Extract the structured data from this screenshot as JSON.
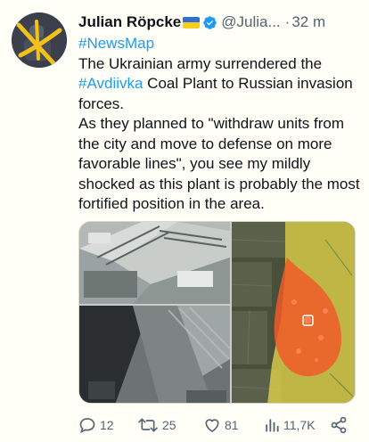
{
  "tweet": {
    "author_name": "Julian Röpcke",
    "flag_icon": "ukraine-flag-icon",
    "handle": "@Julia...",
    "separator": "·",
    "time": "32 m",
    "text": {
      "hashtag_newsmap": "#NewsMap",
      "line_a": "The Ukrainian army surrendered the ",
      "hashtag_avdiivka": "#Avdiivka",
      "line_b": " Coal Plant to Russian invasion forces.",
      "paragraph2": "As they planned to \"withdraw units from the city and move to defense on more favorable lines\", you see my mildly shocked as this plant is probably the most fortified position in the area."
    },
    "media": {
      "images": [
        "coal-plant-aerial-photo",
        "coal-plant-rooftop-photo",
        "satellite-map-with-highlighted-area"
      ]
    },
    "actions": {
      "replies": "12",
      "retweets": "25",
      "likes": "81",
      "views": "11,7K"
    }
  },
  "colors": {
    "link": "#1d9bf0",
    "muted": "#536471",
    "background": "#fffef7",
    "map_highlight": "#e8d84a",
    "map_marker": "#f05a28"
  }
}
